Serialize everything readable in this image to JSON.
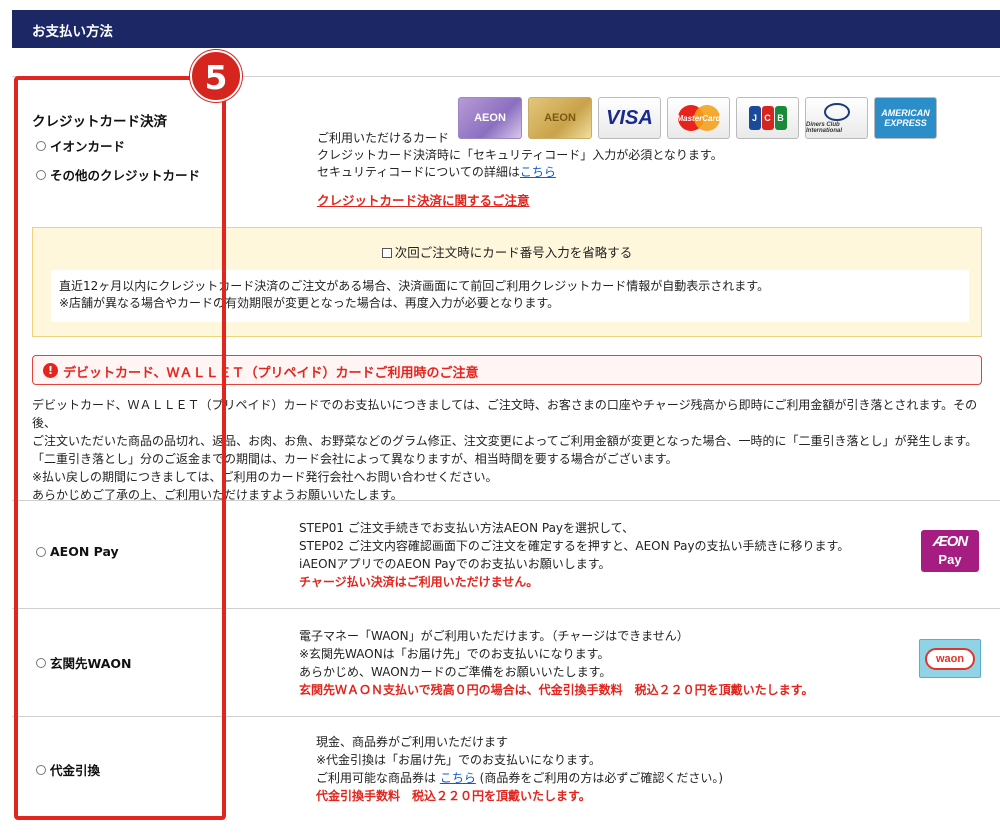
{
  "header": {
    "title": "お支払い方法"
  },
  "step_badge": "5",
  "credit": {
    "heading": "クレジットカード決済",
    "options": [
      "イオンカード",
      "その他のクレジットカード"
    ],
    "cards": [
      {
        "name": "aeon-card-purple",
        "label": "AEON"
      },
      {
        "name": "aeon-card-gold",
        "label": "AEON"
      },
      {
        "name": "visa",
        "label": "VISA"
      },
      {
        "name": "mastercard",
        "label": "MasterCard"
      },
      {
        "name": "jcb",
        "label": "JCB"
      },
      {
        "name": "diners",
        "label": "Diners Club International"
      },
      {
        "name": "amex",
        "label": "AMERICAN EXPRESS"
      }
    ],
    "info_line1": "ご利用いただけるカード",
    "info_line2": "クレジットカード決済時に「セキュリティコード」入力が必須となります。",
    "info_line3_prefix": "セキュリティコードについての詳細は",
    "info_line3_link": "こちら",
    "notice_link": "クレジットカード決済に関するご注意"
  },
  "save_card": {
    "checkbox_label": "次回ご注文時にカード番号入力を省略する",
    "desc1": "直近12ヶ月以内にクレジットカード決済のご注文がある場合、決済画面にて前回ご利用クレジットカード情報が自動表示されます。",
    "desc2": "※店舗が異なる場合やカードの有効期限が変更となった場合は、再度入力が必要となります。"
  },
  "debit": {
    "title": "デビットカード、ＷＡＬＬＥＴ（プリペイド）カードご利用時のご注意",
    "lines": [
      "デビットカード、ＷＡＬＬＥＴ（プリペイド）カードでのお支払いにつきましては、ご注文時、お客さまの口座やチャージ残高から即時にご利用金額が引き落とされます。その後、",
      "ご注文いただいた商品の品切れ、返品、お肉、お魚、お野菜などのグラム修正、注文変更によってご利用金額が変更となった場合、一時的に「二重引き落とし」が発生します。",
      "「二重引き落とし」分のご返金までの期間は、カード会社によって異なりますが、相当時間を要する場合がございます。",
      "※払い戻しの期間につきましては、ご利用のカード発行会社へお問い合わせください。",
      "あらかじめご了承の上、ご利用いただけますようお願いいたします。"
    ]
  },
  "aeon_pay": {
    "label": "AEON Pay",
    "lines": [
      "STEP01 ご注文手続きでお支払い方法AEON Payを選択して、",
      "STEP02 ご注文内容確認画面下のご注文を確定するを押すと、AEON Payの支払い手続きに移ります。",
      "iAEONアプリでのAEON Payでのお支払いお願いします。"
    ],
    "warning": "チャージ払い決済はご利用いただけません。",
    "logo_line1": "ÆON",
    "logo_line2": "Pay"
  },
  "waon": {
    "label": "玄関先WAON",
    "lines": [
      "電子マネー「WAON」がご利用いただけます。（チャージはできません）",
      "※玄関先WAONは「お届け先」でのお支払いになります。",
      "あらかじめ、WAONカードのご準備をお願いいたします。"
    ],
    "warning": "玄関先ＷＡＯＮ支払いで残高０円の場合は、代金引換手数料　税込２２０円を頂戴いたします。",
    "logo": "waon"
  },
  "cod": {
    "label": "代金引換",
    "line1": "現金、商品券がご利用いただけます",
    "line2": "※代金引換は「お届け先」でのお支払いになります。",
    "line3_prefix": "ご利用可能な商品券は ",
    "line3_link": "こちら",
    "line3_suffix": " (商品券をご利用の方は必ずご確認ください。)",
    "warning": "代金引換手数料　税込２２０円を頂戴いたします。"
  },
  "colors": {
    "header_bg": "#1c2766",
    "accent_red": "#e3251d",
    "link_blue": "#0d5bd6"
  }
}
